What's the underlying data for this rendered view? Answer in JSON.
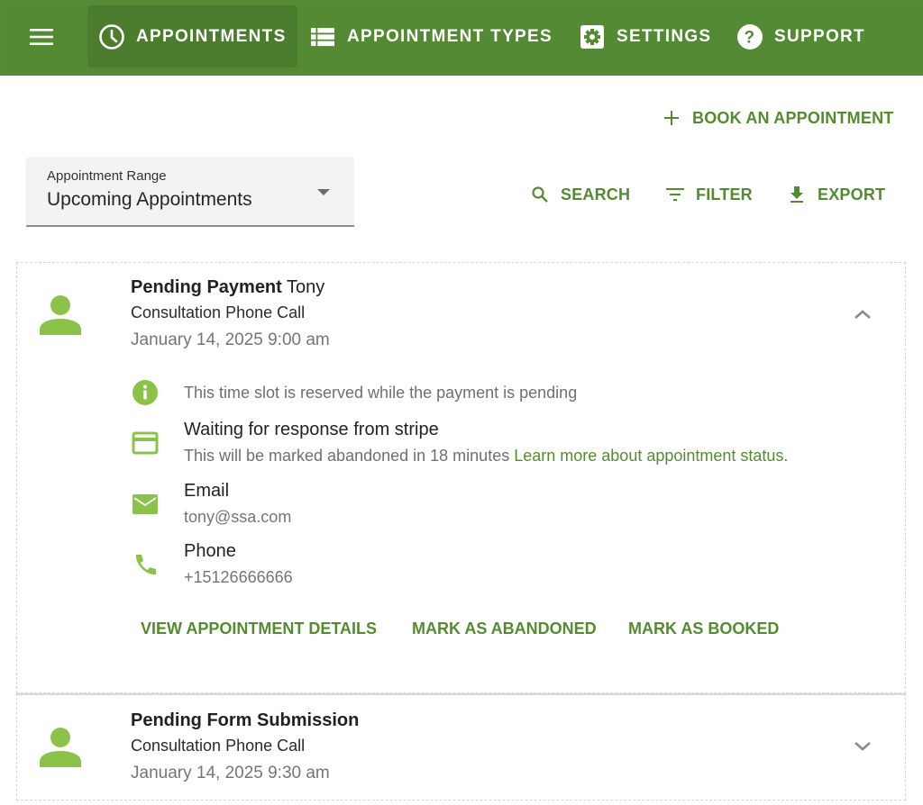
{
  "colors": {
    "brand": "#558b34",
    "accent_text": "#558b2f",
    "icon_green": "#8bc34a"
  },
  "nav": {
    "menu_icon": "hamburger-menu-icon",
    "items": [
      {
        "label": "APPOINTMENTS",
        "icon": "clock-icon",
        "active": true
      },
      {
        "label": "APPOINTMENT TYPES",
        "icon": "list-icon",
        "active": false
      },
      {
        "label": "SETTINGS",
        "icon": "gear-icon",
        "active": false
      },
      {
        "label": "SUPPORT",
        "icon": "help-icon",
        "active": false
      }
    ]
  },
  "toolbar": {
    "book_label": "BOOK AN APPOINTMENT",
    "search_label": "SEARCH",
    "filter_label": "FILTER",
    "export_label": "EXPORT"
  },
  "range_select": {
    "label": "Appointment Range",
    "value": "Upcoming Appointments"
  },
  "appointments": [
    {
      "status": "Pending Payment",
      "name": "Tony",
      "type": "Consultation Phone Call",
      "date": "January 14, 2025 9:00 am",
      "expanded": true,
      "info_note": "This time slot is reserved while the payment is pending",
      "payment_title": "Waiting for response from stripe",
      "payment_sub": "This will be marked abandoned in 18 minutes",
      "payment_link": "Learn more about appointment status.",
      "email_label": "Email",
      "email_value": "tony@ssa.com",
      "phone_label": "Phone",
      "phone_value": "+15126666666",
      "actions": {
        "view_details": "VIEW APPOINTMENT DETAILS",
        "mark_abandoned": "MARK AS ABANDONED",
        "mark_booked": "MARK AS BOOKED"
      }
    },
    {
      "status": "Pending Form Submission",
      "name": "",
      "type": "Consultation Phone Call",
      "date": "January 14, 2025 9:30 am",
      "expanded": false
    }
  ]
}
